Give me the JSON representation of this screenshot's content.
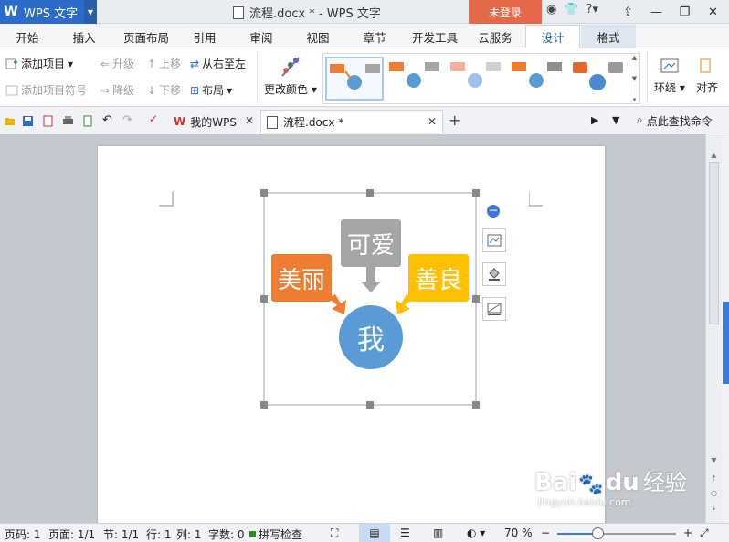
{
  "titlebar": {
    "app_name": "WPS 文字",
    "doc_title": "流程.docx * - WPS 文字",
    "login_label": "未登录",
    "help_label": "?"
  },
  "menu": {
    "tabs": [
      "开始",
      "插入",
      "页面布局",
      "引用",
      "审阅",
      "视图",
      "章节",
      "开发工具",
      "云服务",
      "设计",
      "格式"
    ],
    "active": "设计"
  },
  "ribbon": {
    "add_item": "添加项目",
    "add_bullet": "添加项目符号",
    "promote": "升级",
    "demote": "降级",
    "move_up": "上移",
    "move_down": "下移",
    "right_to_left": "从右至左",
    "layout": "布局",
    "change_color": "更改颜色",
    "layout_ring": "环绕",
    "align": "对齐"
  },
  "tabs_bar": {
    "tabs": [
      {
        "label": "我的WPS"
      },
      {
        "label": "流程.docx *"
      }
    ],
    "search_placeholder": "点此查找命令"
  },
  "diagram": {
    "top": "可爱",
    "left": "美丽",
    "right": "善良",
    "center": "我",
    "colors": {
      "top": "#a5a5a5",
      "left": "#ed7d31",
      "right": "#ffc000",
      "center": "#5b9bd5"
    }
  },
  "statusbar": {
    "page_code": "页码: 1",
    "page": "页面: 1/1",
    "section": "节: 1/1",
    "row": "行: 1",
    "col": "列: 1",
    "word_count": "字数: 0",
    "spell": "拼写检查",
    "zoom": "70 %",
    "zoom_level": 0.35
  },
  "watermark": {
    "brand": "Bai",
    "brand2": "du",
    "cn": "经验",
    "url": "jingyan.baidu.com"
  }
}
